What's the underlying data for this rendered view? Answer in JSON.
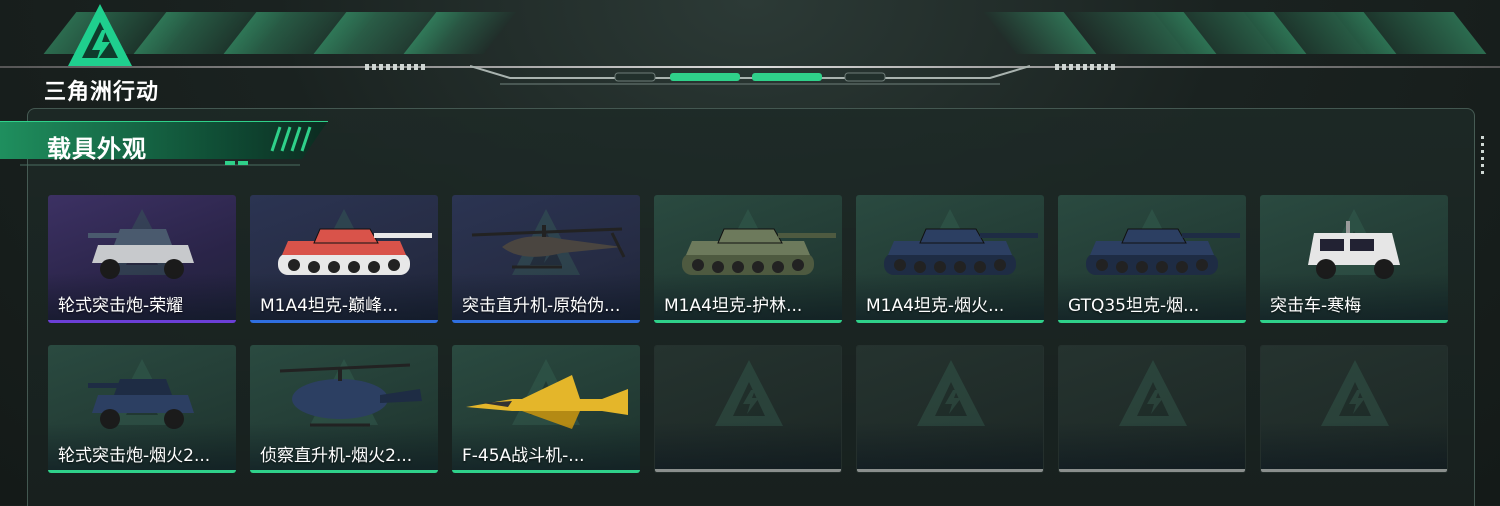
{
  "brand": {
    "logo_text": "三角洲行动",
    "accent": "#2fd18a"
  },
  "section": {
    "title": "载具外观"
  },
  "colors": {
    "rarity_purple": "#6b3fd6",
    "rarity_blue": "#2f6fe0",
    "rarity_green": "#2fd18a",
    "empty": "#8a8f8d"
  },
  "items": [
    {
      "name": "轮式突击炮-荣耀",
      "rarity": "purple",
      "icon": "wheeled-assault-gun-icon"
    },
    {
      "name": "M1A4坦克-巅峰...",
      "rarity": "blue",
      "icon": "tank-icon"
    },
    {
      "name": "突击直升机-原始伪...",
      "rarity": "blue",
      "icon": "attack-helicopter-icon"
    },
    {
      "name": "M1A4坦克-护林...",
      "rarity": "green",
      "icon": "tank-icon"
    },
    {
      "name": "M1A4坦克-烟火...",
      "rarity": "green",
      "icon": "tank-icon"
    },
    {
      "name": "GTQ35坦克-烟...",
      "rarity": "green",
      "icon": "tank-icon"
    },
    {
      "name": "突击车-寒梅",
      "rarity": "green",
      "icon": "assault-vehicle-icon"
    },
    {
      "name": "轮式突击炮-烟火2...",
      "rarity": "green",
      "icon": "wheeled-assault-gun-icon"
    },
    {
      "name": "侦察直升机-烟火2...",
      "rarity": "green",
      "icon": "scout-helicopter-icon"
    },
    {
      "name": "F-45A战斗机-...",
      "rarity": "green",
      "icon": "fighter-jet-icon"
    },
    {
      "name": "",
      "rarity": "empty",
      "icon": "delta-logo-icon"
    },
    {
      "name": "",
      "rarity": "empty",
      "icon": "delta-logo-icon"
    },
    {
      "name": "",
      "rarity": "empty",
      "icon": "delta-logo-icon"
    },
    {
      "name": "",
      "rarity": "empty",
      "icon": "delta-logo-icon"
    }
  ]
}
